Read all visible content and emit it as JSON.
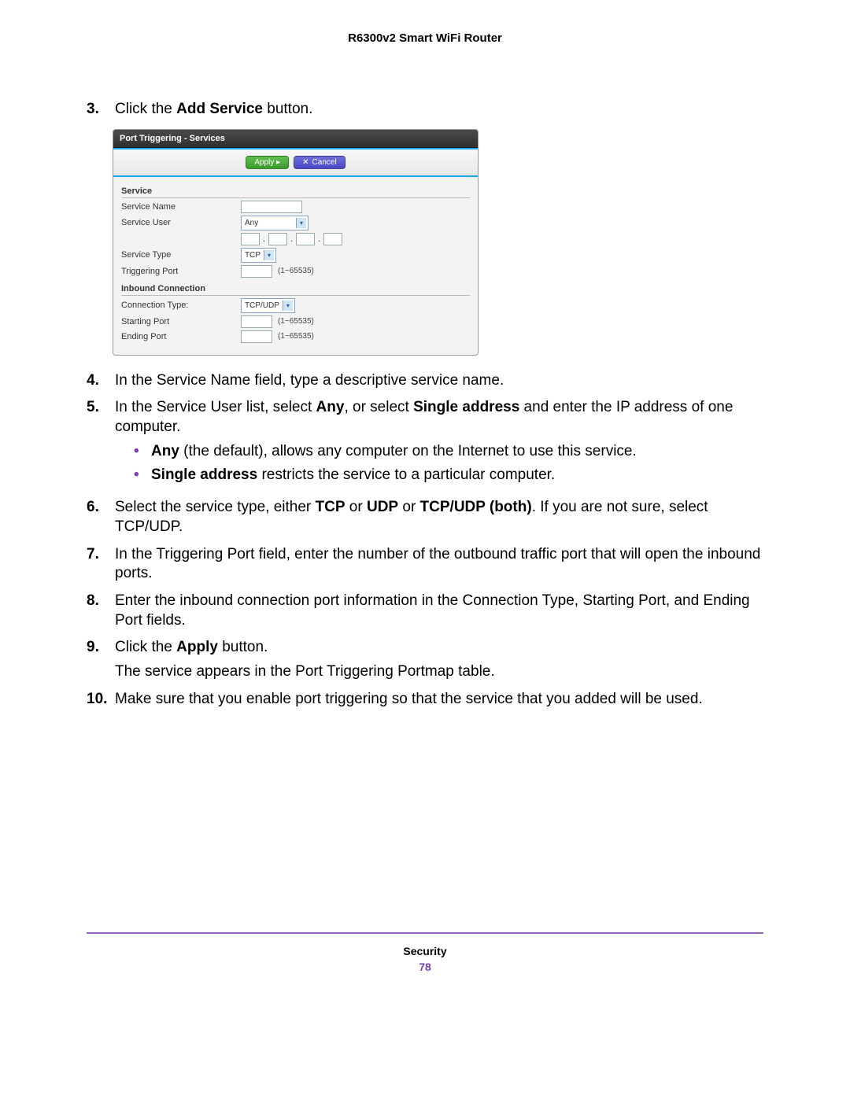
{
  "header": {
    "title": "R6300v2 Smart WiFi Router"
  },
  "steps": {
    "s3": {
      "num": "3.",
      "pre": "Click the ",
      "bold": "Add Service",
      "post": " button."
    },
    "s4": {
      "num": "4.",
      "text": "In the Service Name field, type a descriptive service name."
    },
    "s5": {
      "num": "5.",
      "pre": "In the Service User list, select ",
      "b1": "Any",
      "mid": ", or select ",
      "b2": "Single address",
      "post": " and enter the IP address of one computer."
    },
    "s5a": {
      "b": "Any",
      "text": " (the default), allows any computer on the Internet to use this service."
    },
    "s5b": {
      "b": "Single address",
      "text": " restricts the service to a particular computer."
    },
    "s6": {
      "num": "6.",
      "pre": "Select the service type, either ",
      "b1": "TCP",
      "mid1": " or ",
      "b2": "UDP",
      "mid2": " or ",
      "b3": "TCP/UDP (both)",
      "post": ". If you are not sure, select TCP/UDP."
    },
    "s7": {
      "num": "7.",
      "text": "In the Triggering Port field, enter the number of the outbound traffic port that will open the inbound ports."
    },
    "s8": {
      "num": "8.",
      "text": "Enter the inbound connection port information in the Connection Type, Starting Port, and Ending Port fields."
    },
    "s9": {
      "num": "9.",
      "pre": "Click the ",
      "b": "Apply",
      "post": " button."
    },
    "s9note": "The service appears in the Port Triggering Portmap table.",
    "s10": {
      "num": "10.",
      "text": "Make sure that you enable port triggering so that the service that you added will be used."
    }
  },
  "screenshot": {
    "title": "Port Triggering - Services",
    "apply": "Apply ▸",
    "cancel": "Cancel",
    "cancel_x": "✕",
    "service_section": "Service",
    "rows": {
      "service_name": "Service Name",
      "service_user": "Service User",
      "service_user_value": "Any",
      "service_type": "Service Type",
      "service_type_value": "TCP",
      "triggering_port": "Triggering Port",
      "range_hint": "(1~65535)"
    },
    "inbound_section": "Inbound Connection",
    "inbound": {
      "connection_type": "Connection Type:",
      "connection_type_value": "TCP/UDP",
      "starting_port": "Starting Port",
      "ending_port": "Ending Port"
    }
  },
  "footer": {
    "section": "Security",
    "page": "78"
  },
  "icons": {
    "apply_arrow": "▸",
    "chevron": "▾"
  }
}
